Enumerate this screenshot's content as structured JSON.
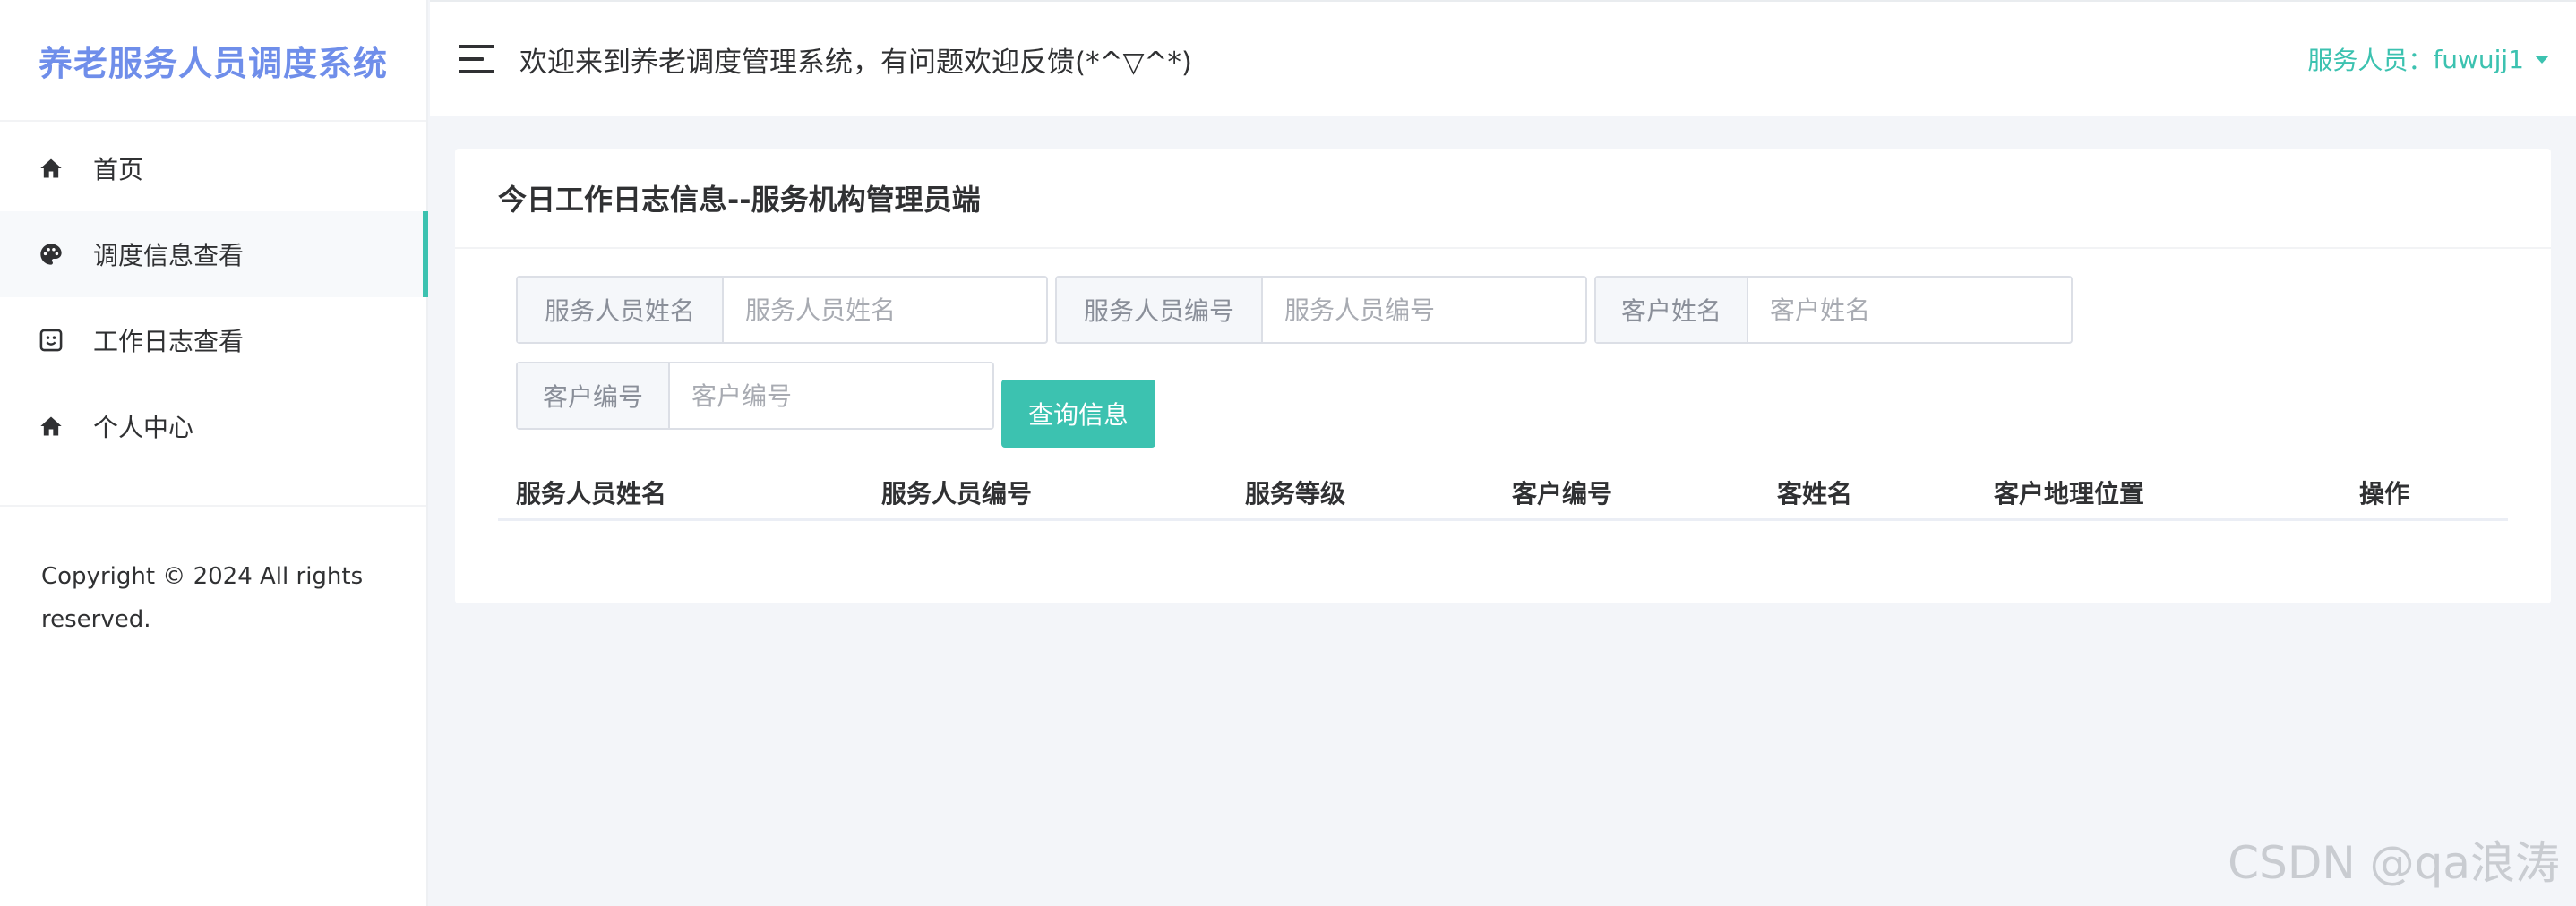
{
  "brand": {
    "title": "养老服务人员调度系统"
  },
  "sidebar": {
    "items": [
      {
        "label": "首页",
        "icon": "home-icon"
      },
      {
        "label": "调度信息查看",
        "icon": "palette-icon"
      },
      {
        "label": "工作日志查看",
        "icon": "face-icon"
      },
      {
        "label": "个人中心",
        "icon": "home-icon"
      }
    ],
    "copyright": "Copyright © 2024 All rights reserved."
  },
  "header": {
    "welcome": "欢迎来到养老调度管理系统，有问题欢迎反馈(*^▽^*)",
    "user_label": "服务人员：",
    "user_name": "fuwujj1"
  },
  "card": {
    "title": "今日工作日志信息--服务机构管理员端",
    "filters": [
      {
        "label": "服务人员姓名",
        "placeholder": "服务人员姓名",
        "value": ""
      },
      {
        "label": "服务人员编号",
        "placeholder": "服务人员编号",
        "value": ""
      },
      {
        "label": "客户姓名",
        "placeholder": "客户姓名",
        "value": ""
      },
      {
        "label": "客户编号",
        "placeholder": "客户编号",
        "value": ""
      }
    ],
    "query_label": "查询信息",
    "columns": [
      "服务人员姓名",
      "服务人员编号",
      "服务等级",
      "客户编号",
      "客姓名",
      "客户地理位置",
      "操作"
    ]
  },
  "colors": {
    "accent": "#3cc2b0",
    "brand": "#6f8eea"
  },
  "watermark": "CSDN @qa浪涛"
}
